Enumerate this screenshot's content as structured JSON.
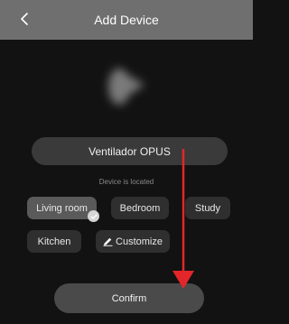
{
  "header": {
    "title": "Add Device",
    "back_icon": "chevron-left-icon"
  },
  "device": {
    "name": "Ventilador OPUS",
    "located_label": "Device is located"
  },
  "rooms": [
    {
      "label": "Living room",
      "selected": true
    },
    {
      "label": "Bedroom",
      "selected": false
    },
    {
      "label": "Study",
      "selected": false
    },
    {
      "label": "Kitchen",
      "selected": false
    }
  ],
  "customize": {
    "label": "Customize",
    "icon": "pencil-icon"
  },
  "confirm_label": "Confirm",
  "colors": {
    "header_bg": "#6f6f6f",
    "background": "#121212",
    "chip_bg": "#2f2f2f",
    "chip_selected_bg": "#5a5a5a",
    "annotation_arrow": "#e3262a"
  }
}
